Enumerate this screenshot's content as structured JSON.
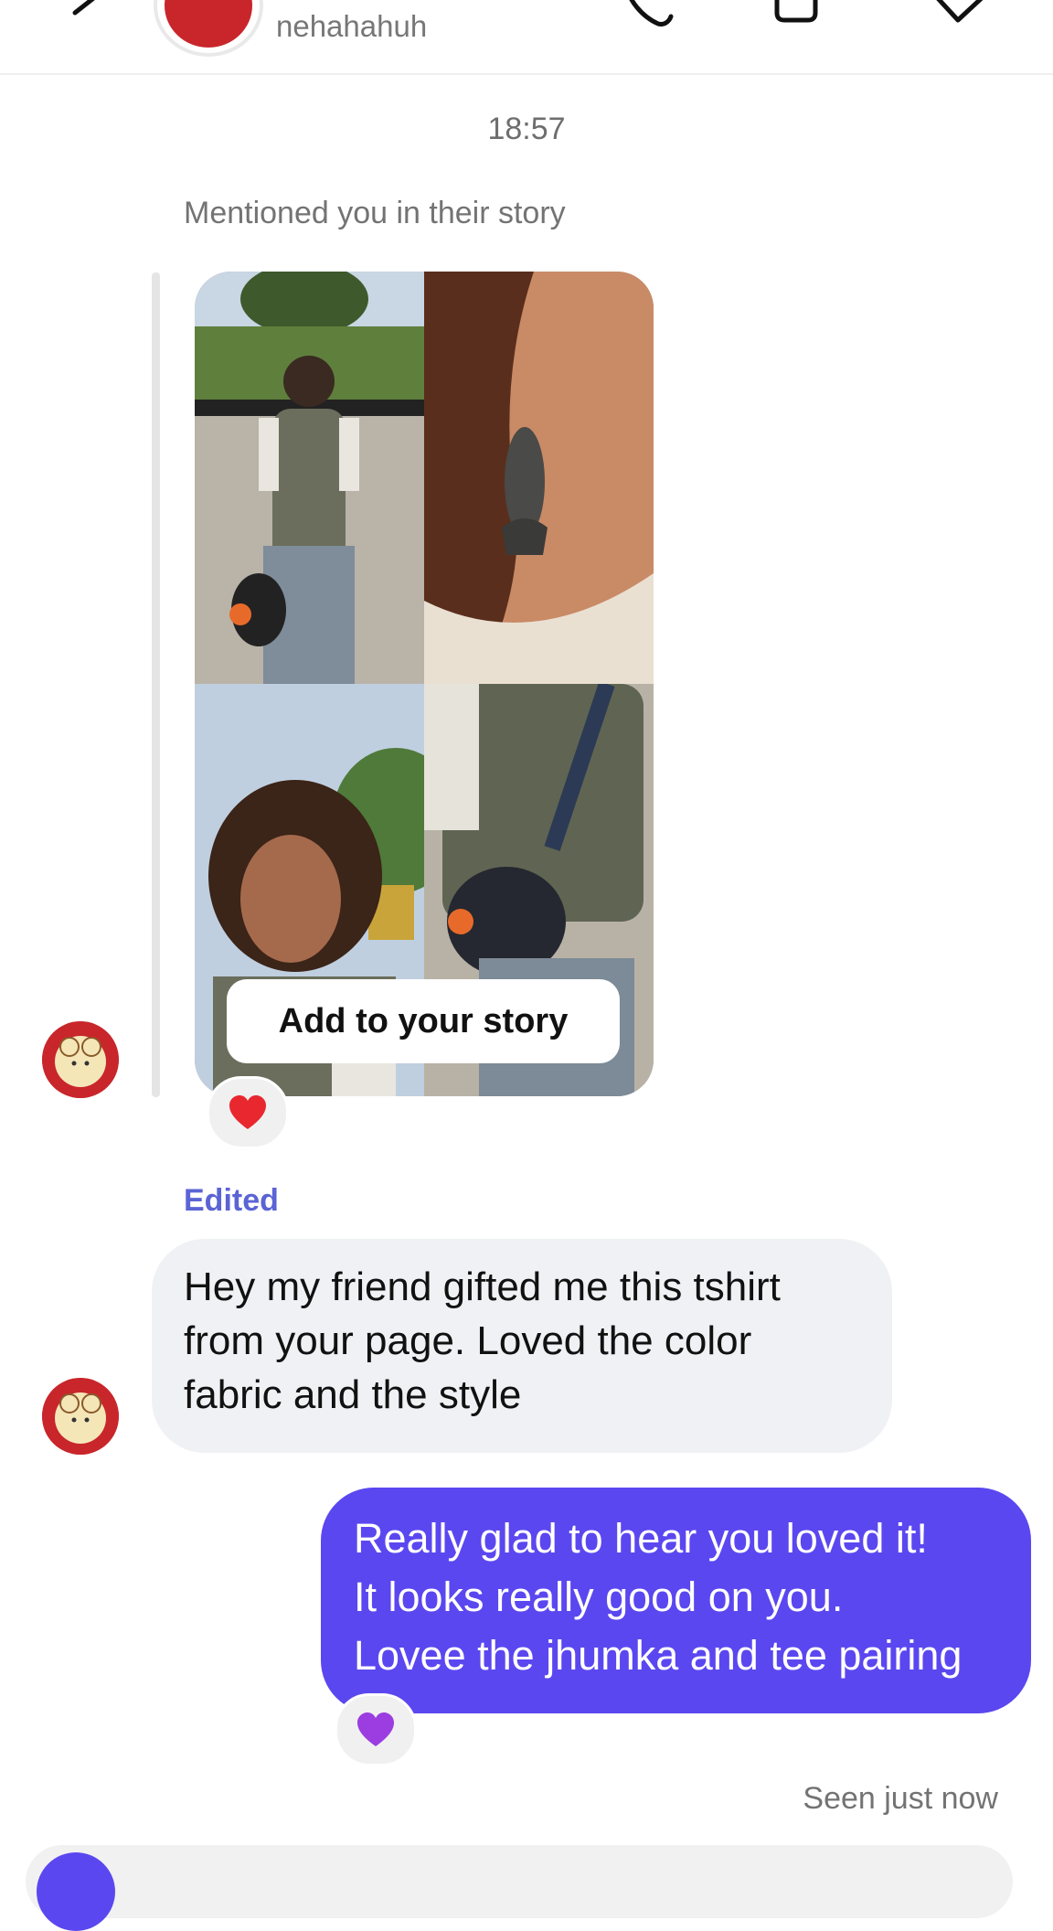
{
  "header": {
    "username": "nehahahuh"
  },
  "chat": {
    "timestamp": "18:57",
    "story_mention": {
      "label": "Mentioned you in their story",
      "add_to_story_label": "Add to your story",
      "reaction_emoji": "❤️"
    },
    "incoming_message": {
      "edited_label": "Edited",
      "lines": [
        "Hey my friend gifted me this tshirt",
        "from your page. Loved the color",
        "fabric and the style"
      ]
    },
    "outgoing_message": {
      "lines": [
        "Really glad to hear you loved it!",
        "It looks really good on you.",
        "Lovee the jhumka and tee pairing"
      ],
      "reaction_emoji": "💜"
    },
    "seen_status": "Seen just now"
  },
  "colors": {
    "outgoing_bubble": "#5b47f0",
    "incoming_bubble": "#eff1f4",
    "edited_label": "#5b64d4",
    "avatar_bg": "#c8262b"
  },
  "icons": [
    "back-arrow-icon",
    "phone-icon",
    "video-camera-icon",
    "tag-icon"
  ]
}
